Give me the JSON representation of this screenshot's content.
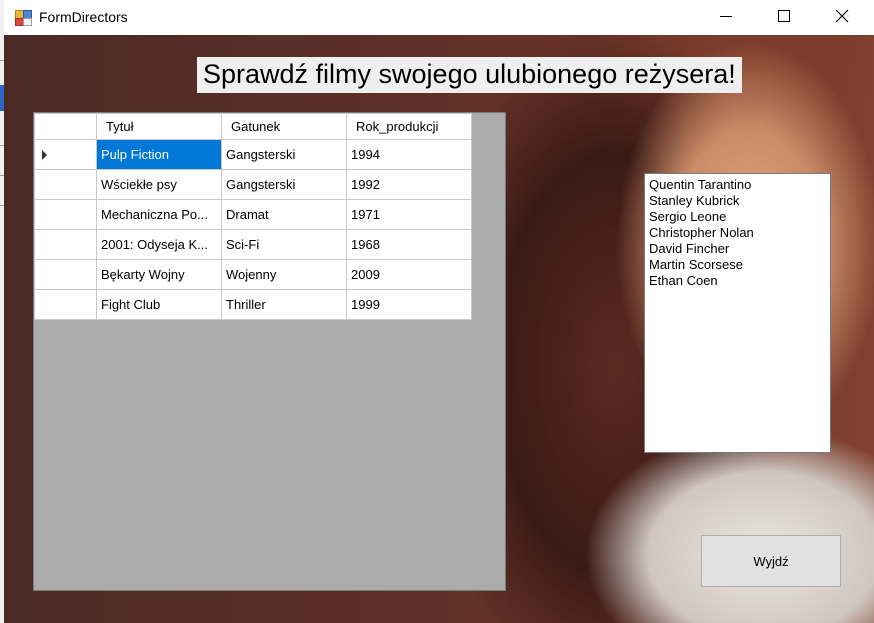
{
  "window": {
    "title": "FormDirectors",
    "icon": "app-form-icon",
    "controls": [
      "minimize-icon",
      "maximize-icon",
      "close-icon"
    ]
  },
  "header": {
    "text": "Sprawdź filmy swojego ulubionego reżysera!"
  },
  "grid": {
    "columns": [
      "Tytuł",
      "Gatunek",
      "Rok_produkcji"
    ],
    "rows": [
      [
        "Pulp Fiction",
        "Gangsterski",
        "1994"
      ],
      [
        "Wściekłe psy",
        "Gangsterski",
        "1992"
      ],
      [
        "Mechaniczna Po...",
        "Dramat",
        "1971"
      ],
      [
        "2001: Odyseja K...",
        "Sci-Fi",
        "1968"
      ],
      [
        "Bękarty Wojny",
        "Wojenny",
        "2009"
      ],
      [
        "Fight Club",
        "Thriller",
        "1999"
      ]
    ],
    "current_row_indicator": "row-arrow-icon",
    "selection_color": "#0078d7"
  },
  "directors": {
    "items": [
      "Quentin Tarantino",
      "Stanley Kubrick",
      "Sergio Leone",
      "Christopher Nolan",
      "David Fincher",
      "Martin Scorsese",
      "Ethan Coen"
    ]
  },
  "buttons": {
    "exit": "Wyjdź"
  }
}
